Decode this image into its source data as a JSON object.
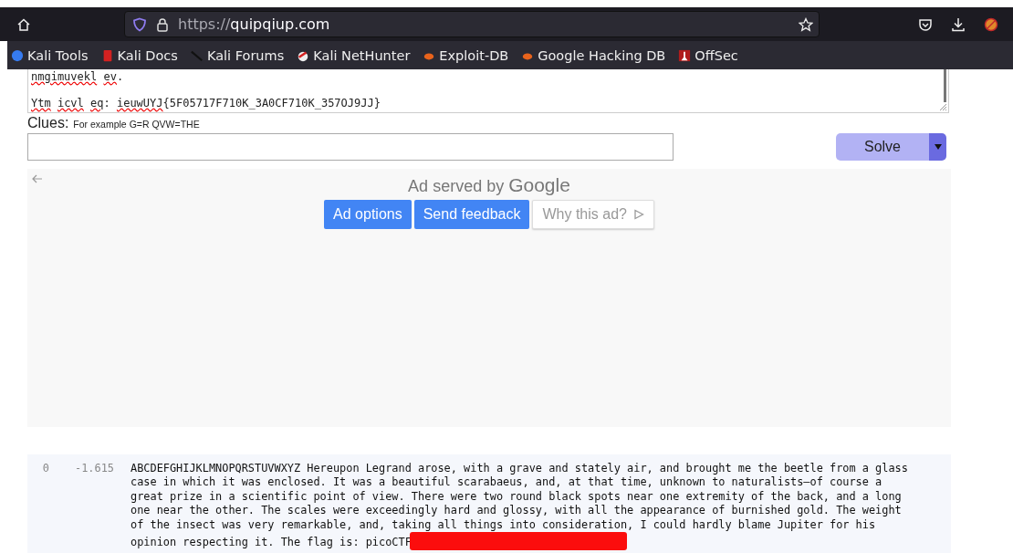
{
  "browser": {
    "url_scheme": "https://",
    "url_host": "quipqiup.com"
  },
  "bookmarks": [
    {
      "label": "Kali Tools",
      "kind": "kali"
    },
    {
      "label": "Kali Docs",
      "kind": "docs"
    },
    {
      "label": "Kali Forums",
      "kind": "forums"
    },
    {
      "label": "Kali NetHunter",
      "kind": "nethunter"
    },
    {
      "label": "Exploit-DB",
      "kind": "bug"
    },
    {
      "label": "Google Hacking DB",
      "kind": "bug"
    },
    {
      "label": "OffSec",
      "kind": "offsec"
    }
  ],
  "puzzle_lines": [
    [
      {
        "text": "nmgimuvekl",
        "misspelled": true,
        "joined": false
      },
      {
        "text": "ev",
        "misspelled": true,
        "joined": false
      },
      {
        "text": ".",
        "misspelled": false,
        "joined": true
      }
    ],
    [
      {
        "text": "Ytm",
        "misspelled": true,
        "joined": false
      },
      {
        "text": "icvl",
        "misspelled": true,
        "joined": false
      },
      {
        "text": "eq",
        "misspelled": true,
        "joined": false
      },
      {
        "text": ":",
        "misspelled": false,
        "joined": true
      },
      {
        "text": "ieuwUYJ",
        "misspelled": true,
        "joined": false
      },
      {
        "text": "{5F05717F710K_3A0CF710K_357OJ9JJ}",
        "misspelled": false,
        "joined": true
      }
    ]
  ],
  "clues": {
    "label": "Clues:",
    "hint": "For example G=R QVW=THE"
  },
  "solve_button": "Solve",
  "ad": {
    "served_by": "Ad served by",
    "brand": "Google",
    "buttons": [
      {
        "label": "Ad options",
        "kind": "primary"
      },
      {
        "label": "Send feedback",
        "kind": "primary"
      },
      {
        "label": "Why this ad?",
        "kind": "plain"
      }
    ]
  },
  "results": [
    {
      "index": "0",
      "score": "-1.615",
      "lines": [
        "ABCDEFGHIJKLMNOPQRSTUVWXYZ Hereupon Legrand arose, with a grave and stately air, and brought me the beetle from a glass",
        "case in which it was enclosed. It was a beautiful scarabaeus, and, at that time, unknown to naturalists—of course a",
        "great prize in a scientific point of view. There were two round black spots near one extremity of the back, and a long",
        "one near the other. The scales were exceedingly hard and glossy, with all the appearance of burnished gold. The weight",
        "of the insect was very remarkable, and, taking all things into consideration, I could hardly blame Jupiter for his",
        "opinion respecting it. The flag is: picoCTF"
      ],
      "redacted": true
    }
  ]
}
